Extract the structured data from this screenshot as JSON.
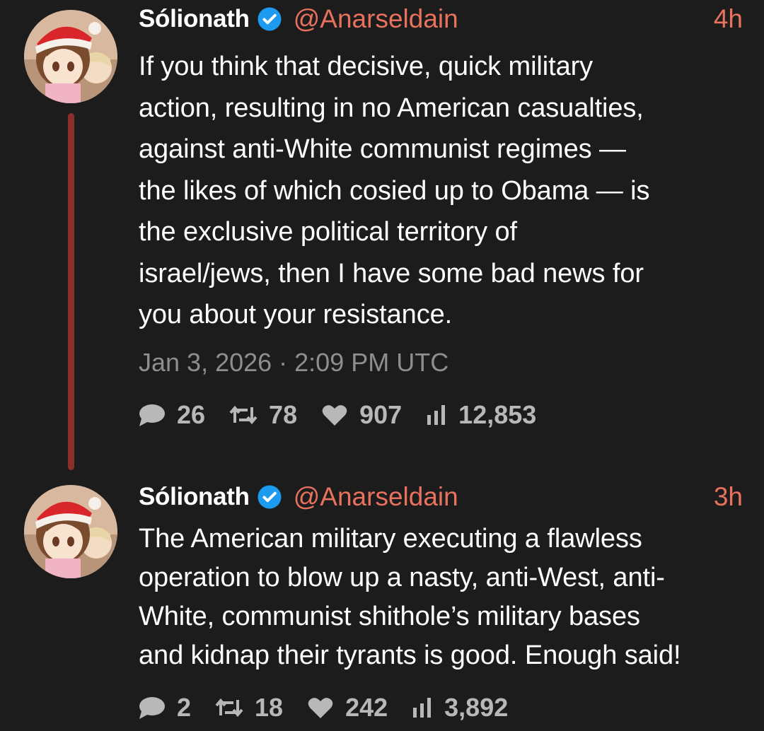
{
  "tweets": [
    {
      "display_name": "Sólionath",
      "handle": "@Anarseldain",
      "time_ago": "4h",
      "lines": [
        "If you think that decisive, quick military",
        "action, resulting in no American casualties,",
        "against anti-White communist regimes —",
        "the likes of which cosied up to Obama — is",
        "the exclusive political territory of",
        "israel/jews, then I have some bad news for",
        "you about your resistance."
      ],
      "timestamp": "Jan 3, 2026 · 2:09 PM UTC",
      "stats": {
        "replies": "26",
        "retweets": "78",
        "likes": "907",
        "views": "12,853"
      }
    },
    {
      "display_name": "Sólionath",
      "handle": "@Anarseldain",
      "time_ago": "3h",
      "lines": [
        "The American military executing a flawless",
        "operation to blow up a nasty, anti-West, anti-",
        "White, communist shithole’s military bases",
        "and kidnap their tyrants is good. Enough said!"
      ],
      "stats": {
        "replies": "2",
        "retweets": "18",
        "likes": "242",
        "views": "3,892"
      }
    }
  ],
  "colors": {
    "background": "#1c1c1c",
    "accent": "#e8725d",
    "thread_line": "#8b2e2a",
    "verified": "#1d9bf0",
    "muted_text": "#8e8e8e",
    "stat_text": "#b8b8b8"
  },
  "icons": [
    "avatar",
    "verified-badge-icon",
    "reply-icon",
    "retweet-icon",
    "like-icon",
    "views-icon"
  ]
}
